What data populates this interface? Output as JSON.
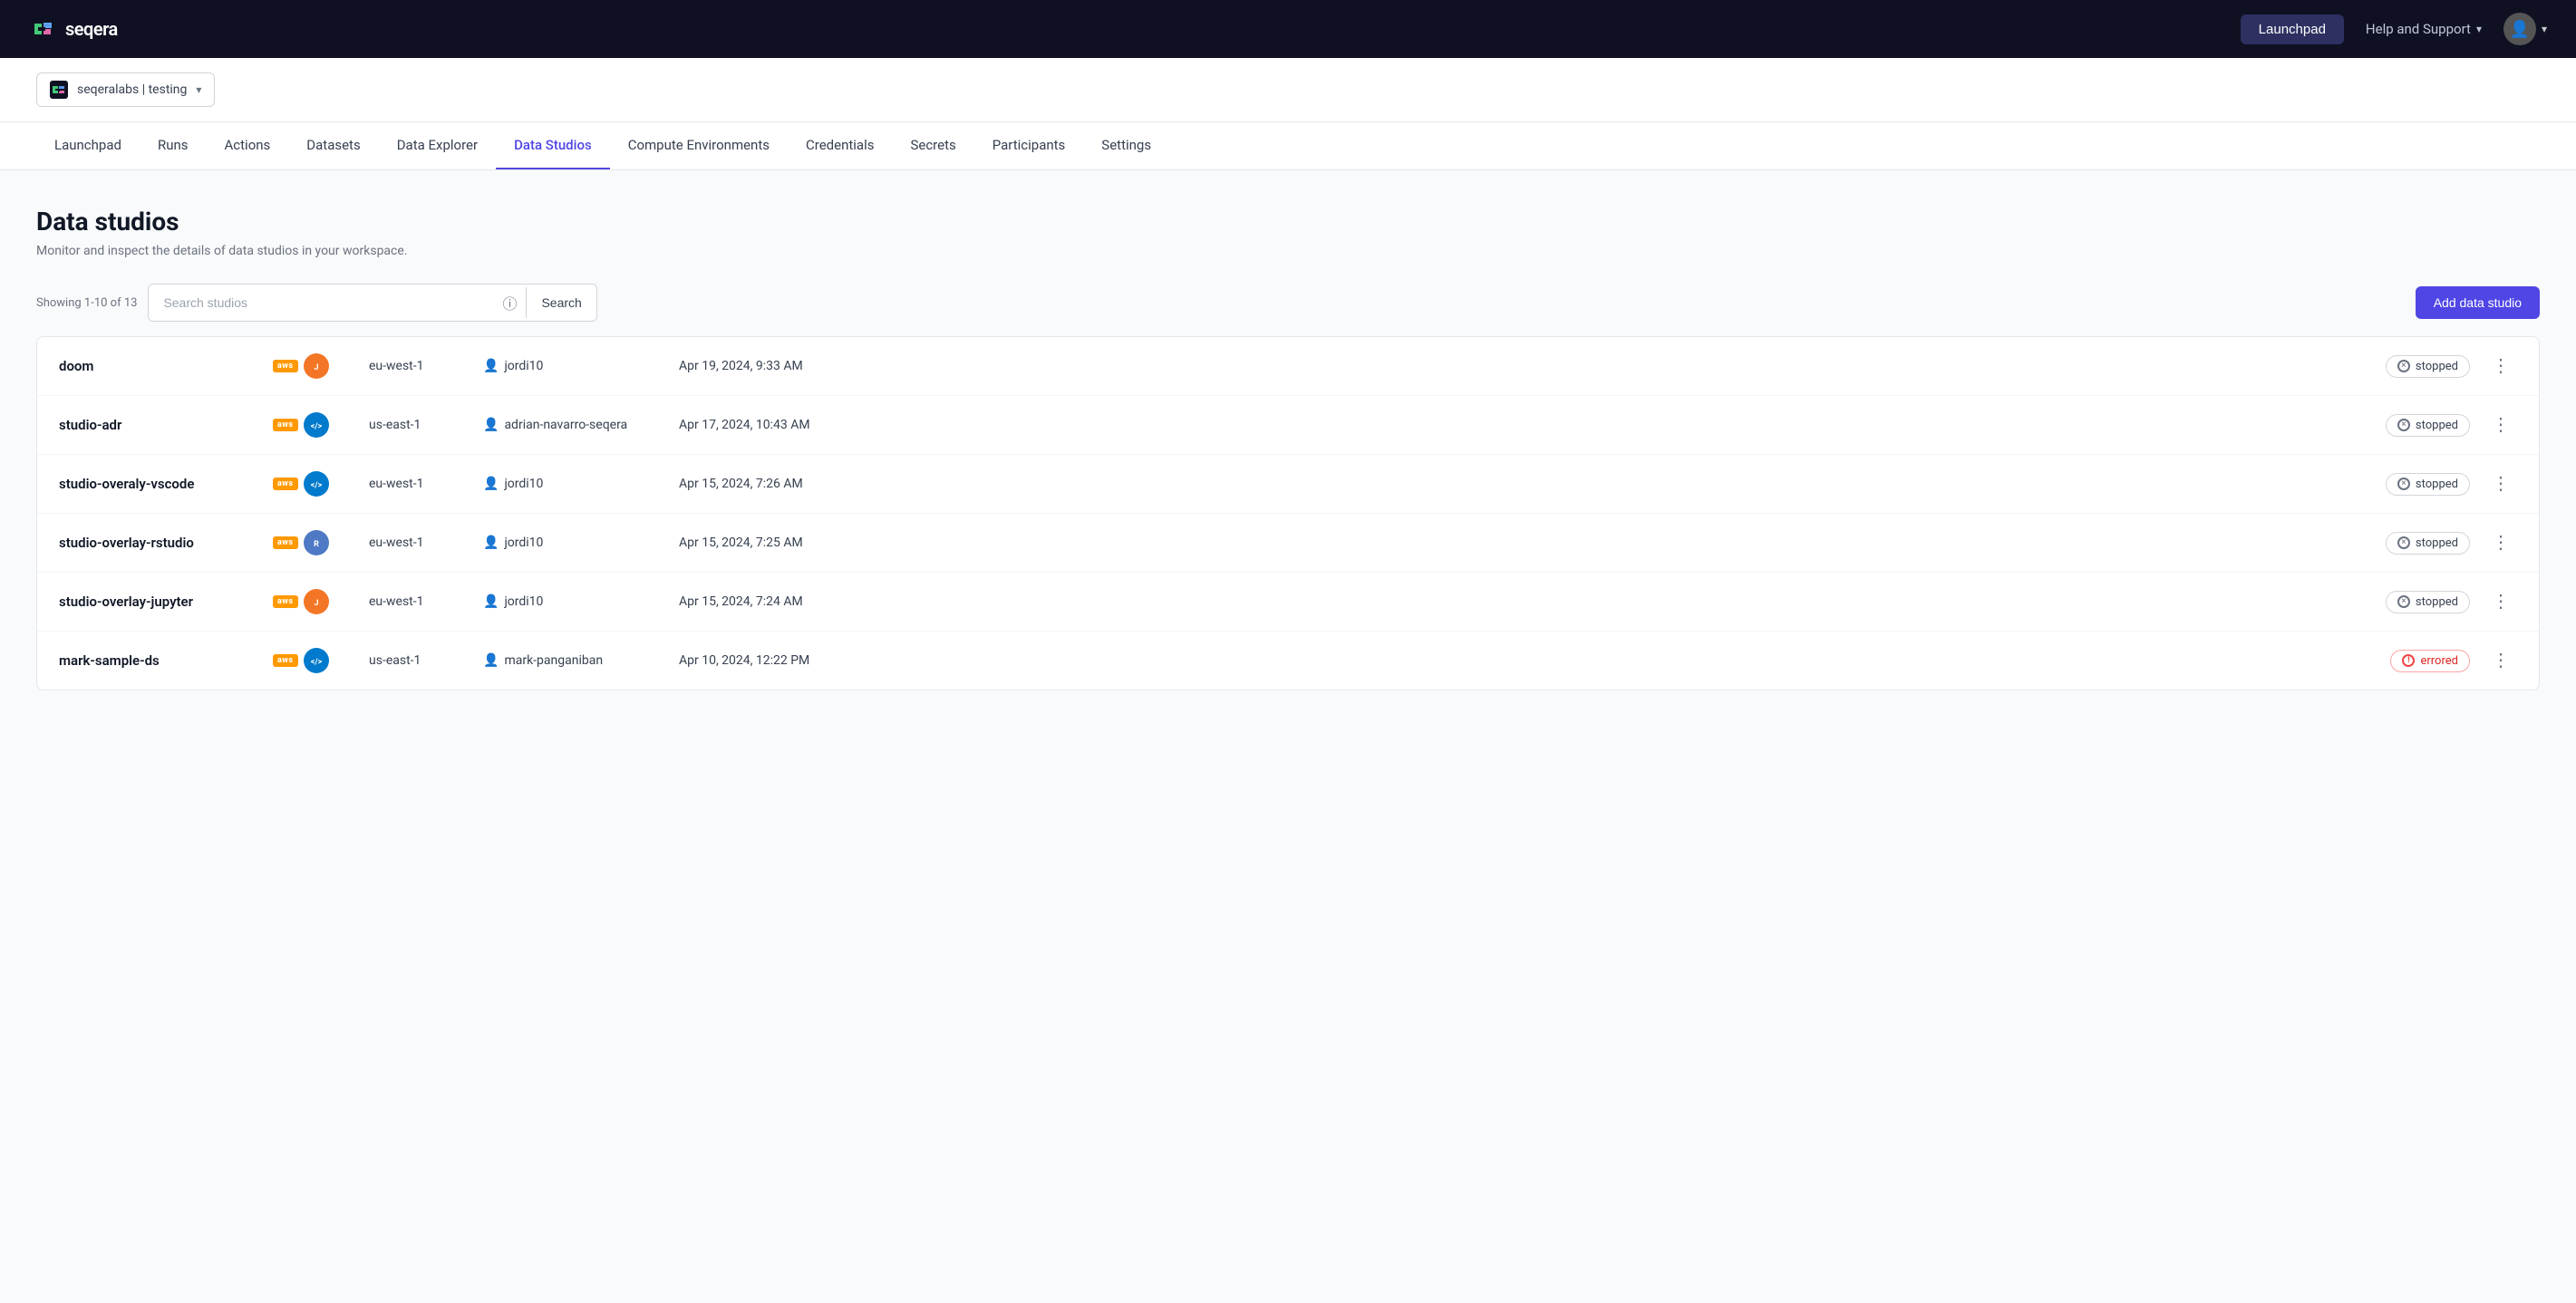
{
  "navbar": {
    "logo_text": "seqera",
    "launchpad_btn": "Launchpad",
    "help_support": "Help and Support"
  },
  "workspace": {
    "label": "seqeralabs | testing"
  },
  "nav_tabs": {
    "items": [
      {
        "id": "launchpad",
        "label": "Launchpad",
        "active": false
      },
      {
        "id": "runs",
        "label": "Runs",
        "active": false
      },
      {
        "id": "actions",
        "label": "Actions",
        "active": false
      },
      {
        "id": "datasets",
        "label": "Datasets",
        "active": false
      },
      {
        "id": "data-explorer",
        "label": "Data Explorer",
        "active": false
      },
      {
        "id": "data-studios",
        "label": "Data Studios",
        "active": true
      },
      {
        "id": "compute-environments",
        "label": "Compute Environments",
        "active": false
      },
      {
        "id": "credentials",
        "label": "Credentials",
        "active": false
      },
      {
        "id": "secrets",
        "label": "Secrets",
        "active": false
      },
      {
        "id": "participants",
        "label": "Participants",
        "active": false
      },
      {
        "id": "settings",
        "label": "Settings",
        "active": false
      }
    ]
  },
  "page": {
    "title": "Data studios",
    "subtitle": "Monitor and inspect the details of data studios in your workspace.",
    "showing_label": "Showing 1-10 of 13",
    "search_placeholder": "Search studios",
    "search_btn": "Search",
    "add_btn": "Add data studio"
  },
  "studios": [
    {
      "name": "doom",
      "provider": "aws",
      "tool": "jupyter",
      "region": "eu-west-1",
      "user": "jordi10",
      "date": "Apr 19, 2024, 9:33 AM",
      "status": "stopped",
      "status_type": "stopped"
    },
    {
      "name": "studio-adr",
      "provider": "aws",
      "tool": "vscode",
      "region": "us-east-1",
      "user": "adrian-navarro-seqera",
      "date": "Apr 17, 2024, 10:43 AM",
      "status": "stopped",
      "status_type": "stopped"
    },
    {
      "name": "studio-overaly-vscode",
      "provider": "aws",
      "tool": "vscode",
      "region": "eu-west-1",
      "user": "jordi10",
      "date": "Apr 15, 2024, 7:26 AM",
      "status": "stopped",
      "status_type": "stopped"
    },
    {
      "name": "studio-overlay-rstudio",
      "provider": "aws",
      "tool": "rstudio",
      "region": "eu-west-1",
      "user": "jordi10",
      "date": "Apr 15, 2024, 7:25 AM",
      "status": "stopped",
      "status_type": "stopped"
    },
    {
      "name": "studio-overlay-jupyter",
      "provider": "aws",
      "tool": "jupyter",
      "region": "eu-west-1",
      "user": "jordi10",
      "date": "Apr 15, 2024, 7:24 AM",
      "status": "stopped",
      "status_type": "stopped"
    },
    {
      "name": "mark-sample-ds",
      "provider": "aws",
      "tool": "vscode",
      "region": "us-east-1",
      "user": "mark-panganiban",
      "date": "Apr 10, 2024, 12:22 PM",
      "status": "errored",
      "status_type": "errored"
    }
  ]
}
